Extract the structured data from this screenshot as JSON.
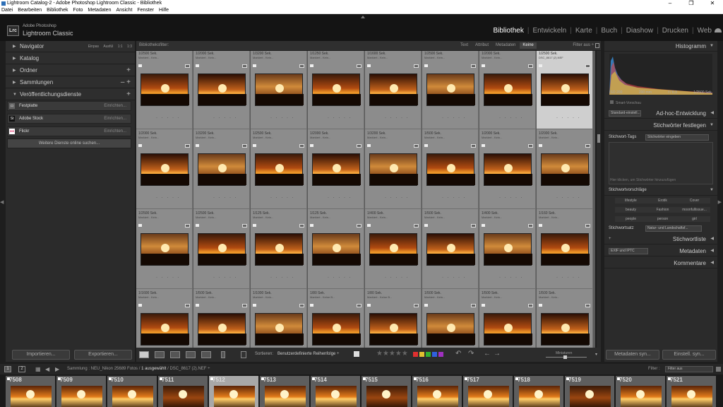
{
  "window": {
    "title": "Lightroom Catalog-2 - Adobe Photoshop Lightroom Classic - Bibliothek",
    "controls": [
      "–",
      "❐",
      "✕"
    ]
  },
  "menu": [
    "Datei",
    "Bearbeiten",
    "Bibliothek",
    "Foto",
    "Metadaten",
    "Ansicht",
    "Fenster",
    "Hilfe"
  ],
  "brand": {
    "logo": "Lrc",
    "line1": "Adobe Photoshop",
    "line2": "Lightroom Classic"
  },
  "modules": [
    {
      "label": "Bibliothek",
      "active": true
    },
    {
      "label": "Entwickeln"
    },
    {
      "label": "Karte"
    },
    {
      "label": "Buch"
    },
    {
      "label": "Diashow"
    },
    {
      "label": "Drucken"
    },
    {
      "label": "Web"
    }
  ],
  "left_panel": {
    "navigator": {
      "label": "Navigator",
      "options": [
        "Einpas",
        "Ausfül",
        "1:1",
        "1:3"
      ]
    },
    "sections": [
      {
        "label": "Katalog",
        "action": ""
      },
      {
        "label": "Ordner",
        "action": "+"
      },
      {
        "label": "Sammlungen",
        "action": "– +"
      },
      {
        "label": "Veröffentlichungsdienste",
        "action": "+"
      }
    ],
    "services": [
      {
        "icon": "▭",
        "label": "Festplatte",
        "action": "Einrichten..."
      },
      {
        "icon": "St",
        "label": "Adobe Stock",
        "action": "Einrichten..."
      },
      {
        "icon": "●●",
        "label": "Flickr",
        "action": "Einrichten..."
      }
    ],
    "more_services": "Weitere Dienste online suchen...",
    "import_label": "Importieren...",
    "export_label": "Exportieren..."
  },
  "filter_bar": {
    "label": "Bibliotheksfilter:",
    "tabs": [
      {
        "label": "Text"
      },
      {
        "label": "Attribut"
      },
      {
        "label": "Metadaten"
      },
      {
        "label": "Keine",
        "selected": true
      }
    ],
    "filter_off": "Filter aus ÷"
  },
  "grid": {
    "rows": [
      [
        {
          "shutter": "1/2500 Sek.",
          "meta": "Markiert - Kein..."
        },
        {
          "shutter": "1/2000 Sek.",
          "meta": "Markiert - Kein..."
        },
        {
          "shutter": "1/3200 Sek.",
          "meta": "Markiert - Kein..."
        },
        {
          "shutter": "1/1250 Sek.",
          "meta": "Markiert - Kein..."
        },
        {
          "shutter": "1/1600 Sek.",
          "meta": "Markiert - Kein..."
        },
        {
          "shutter": "1/2500 Sek.",
          "meta": "Markiert - Kein..."
        },
        {
          "shutter": "1/2000 Sek.",
          "meta": "Markiert - Kein..."
        },
        {
          "shutter": "1/2500 Sek.",
          "meta": "DSC_8617 (2).NEF",
          "selected": true
        }
      ],
      [
        {
          "shutter": "1/2000 Sek.",
          "meta": "Markiert - Kein..."
        },
        {
          "shutter": "1/3200 Sek.",
          "meta": "Markiert - Kein..."
        },
        {
          "shutter": "1/2500 Sek.",
          "meta": "Markiert - Kein..."
        },
        {
          "shutter": "1/2000 Sek.",
          "meta": "Markiert - Kein..."
        },
        {
          "shutter": "1/3200 Sek.",
          "meta": "Markiert - Kein..."
        },
        {
          "shutter": "1/500 Sek.",
          "meta": "Markiert - Kein..."
        },
        {
          "shutter": "1/2000 Sek.",
          "meta": "Markiert - Kein..."
        },
        {
          "shutter": "1/2000 Sek.",
          "meta": "Markiert - Kein..."
        }
      ],
      [
        {
          "shutter": "1/2500 Sek.",
          "meta": "Markiert - Kein..."
        },
        {
          "shutter": "1/2500 Sek.",
          "meta": "Markiert - Kein..."
        },
        {
          "shutter": "1/125 Sek.",
          "meta": "Markiert - Kein..."
        },
        {
          "shutter": "1/125 Sek.",
          "meta": "Markiert - Kein..."
        },
        {
          "shutter": "1/400 Sek.",
          "meta": "Markiert - Kein..."
        },
        {
          "shutter": "1/500 Sek.",
          "meta": "Markiert - Kein..."
        },
        {
          "shutter": "1/400 Sek.",
          "meta": "Markiert - Kein..."
        },
        {
          "shutter": "1/160 Sek.",
          "meta": "Markiert - Kein..."
        }
      ],
      [
        {
          "shutter": "1/1600 Sek.",
          "meta": "Markiert - Kein..."
        },
        {
          "shutter": "1/500 Sek.",
          "meta": "Markiert - Kein..."
        },
        {
          "shutter": "1/1000 Sek.",
          "meta": "Markiert - Kein..."
        },
        {
          "shutter": "1/80 Sek.",
          "meta": "Markiert - Keine B..."
        },
        {
          "shutter": "1/80 Sek.",
          "meta": "Markiert - Keine B..."
        },
        {
          "shutter": "1/500 Sek.",
          "meta": "Markiert - Kein..."
        },
        {
          "shutter": "1/500 Sek.",
          "meta": "Markiert - Kein..."
        },
        {
          "shutter": "1/500 Sek.",
          "meta": "Markiert - Kein..."
        }
      ]
    ]
  },
  "toolbar": {
    "sort_label": "Sortieren:",
    "sort_value": "Benutzerdefinierte Reihenfolge ÷",
    "stars": "★★★★★",
    "color_labels": [
      "#e03030",
      "#e0c030",
      "#30b030",
      "#3060e0",
      "#a030c0"
    ],
    "zoom_label": "Miniaturen"
  },
  "right_panel": {
    "histogram": {
      "label": "Histogramm",
      "iso": "ISO 200",
      "focal": "200 mm",
      "aperture": "f / 6,3",
      "shutter": "1/2500 Sek."
    },
    "smart_preview": "Smart-Vorschau",
    "quick_develop": {
      "preset": "Standard-einstell...",
      "label": "Ad-hoc-Entwicklung"
    },
    "keywording": {
      "label": "Stichwörter festlegen",
      "tags_label": "Stichwort-Tags",
      "tags_value": "Stichwörter eingeben",
      "hint": "Hier klicken, um Stichwörter hinzuzufügen",
      "suggestions_label": "Stichwortvorschläge",
      "suggestions": [
        "lifestyle",
        "Erotik",
        "Cover",
        "beauty",
        "Fashion",
        "moonfullissue...",
        "people",
        "person",
        "girl"
      ],
      "set_label": "Stichwortsatz",
      "set_value": "Natur- und Landschaftsf..."
    },
    "keyword_list": "Stichwortliste",
    "metadata": {
      "preset": "EXIF und IPTC",
      "label": "Metadaten"
    },
    "comments": "Kommentare",
    "sync_metadata": "Metadaten syn...",
    "sync_settings": "Einstell. syn..."
  },
  "filmstrip_bar": {
    "page1": "1",
    "page2": "2",
    "path": "Sammlung : NEU_Nikon",
    "count": "25689 Fotos /",
    "selected": "1 ausgewählt",
    "file": "/ DSC_8617 (2).NEF ÷",
    "filter_label": "Filter :",
    "filter_value": "Filter aus"
  },
  "filmstrip": [
    {
      "num": "7508"
    },
    {
      "num": "7509"
    },
    {
      "num": "7510"
    },
    {
      "num": "7511"
    },
    {
      "num": "7512",
      "selected": true
    },
    {
      "num": "7513"
    },
    {
      "num": "7514"
    },
    {
      "num": "7515"
    },
    {
      "num": "7516"
    },
    {
      "num": "7517"
    },
    {
      "num": "7518"
    },
    {
      "num": "7519"
    },
    {
      "num": "7520"
    },
    {
      "num": "7521"
    }
  ]
}
